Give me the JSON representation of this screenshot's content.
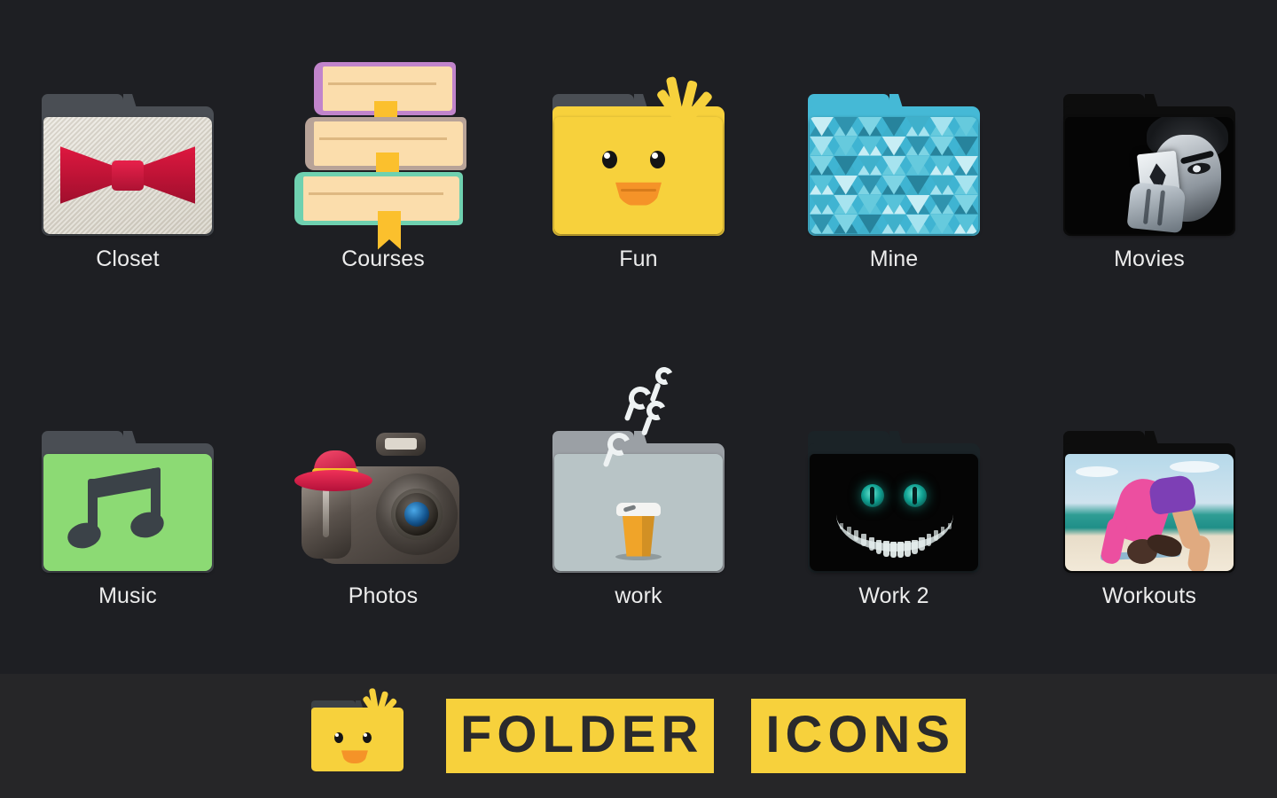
{
  "app": {
    "background_color": "#1e1f23",
    "footer_background_color": "#262628",
    "accent_color": "#f7d13c",
    "label_color": "#ececec"
  },
  "grid": {
    "columns": 5,
    "rows": 2,
    "items": [
      {
        "label": "Closet",
        "icon": "bow-tie-fabric-folder-icon",
        "icon_style": "photo",
        "colors": {
          "primary": "#d1143a",
          "secondary": "#e7e3da"
        }
      },
      {
        "label": "Courses",
        "icon": "book-stack-folder-icon",
        "icon_style": "flat",
        "colors": {
          "primary": "#c184cb",
          "secondary": "#6fd1b0",
          "tertiary": "#fbc02d"
        }
      },
      {
        "label": "Fun",
        "icon": "chick-face-folder-icon",
        "icon_style": "flat",
        "colors": {
          "primary": "#f7d13c",
          "secondary": "#f59328"
        }
      },
      {
        "label": "Mine",
        "icon": "low-poly-triangles-folder-icon",
        "icon_style": "pattern",
        "colors": {
          "primary": "#45b9d6",
          "secondary": "#a9e2ee"
        }
      },
      {
        "label": "Movies",
        "icon": "joker-folder-icon",
        "icon_style": "photo",
        "colors": {
          "primary": "#050505",
          "secondary": "#dfe4e8"
        }
      },
      {
        "label": "Music",
        "icon": "music-note-folder-icon",
        "icon_style": "flat",
        "colors": {
          "primary": "#8cda74",
          "secondary": "#3b4248"
        }
      },
      {
        "label": "Photos",
        "icon": "dslr-camera-with-hat-folder-icon",
        "icon_style": "3d",
        "colors": {
          "primary": "#5d554f",
          "secondary": "#ef3158"
        }
      },
      {
        "label": "work",
        "icon": "coffee-cup-steam-folder-icon",
        "icon_style": "flat",
        "colors": {
          "primary": "#b8c4c6",
          "secondary": "#f0a429"
        }
      },
      {
        "label": "Work 2",
        "icon": "cheshire-cat-folder-icon",
        "icon_style": "photo",
        "colors": {
          "primary": "#050505",
          "secondary": "#11a394"
        }
      },
      {
        "label": "Workouts",
        "icon": "beach-yoga-backbend-folder-icon",
        "icon_style": "photo",
        "colors": {
          "primary": "#ec4fa0",
          "secondary": "#2f9d94"
        }
      }
    ]
  },
  "footer": {
    "logo_icon": "chick-folder-logo-icon",
    "wordmark": [
      {
        "text": "FOLDER"
      },
      {
        "text": "ICONS"
      }
    ]
  }
}
